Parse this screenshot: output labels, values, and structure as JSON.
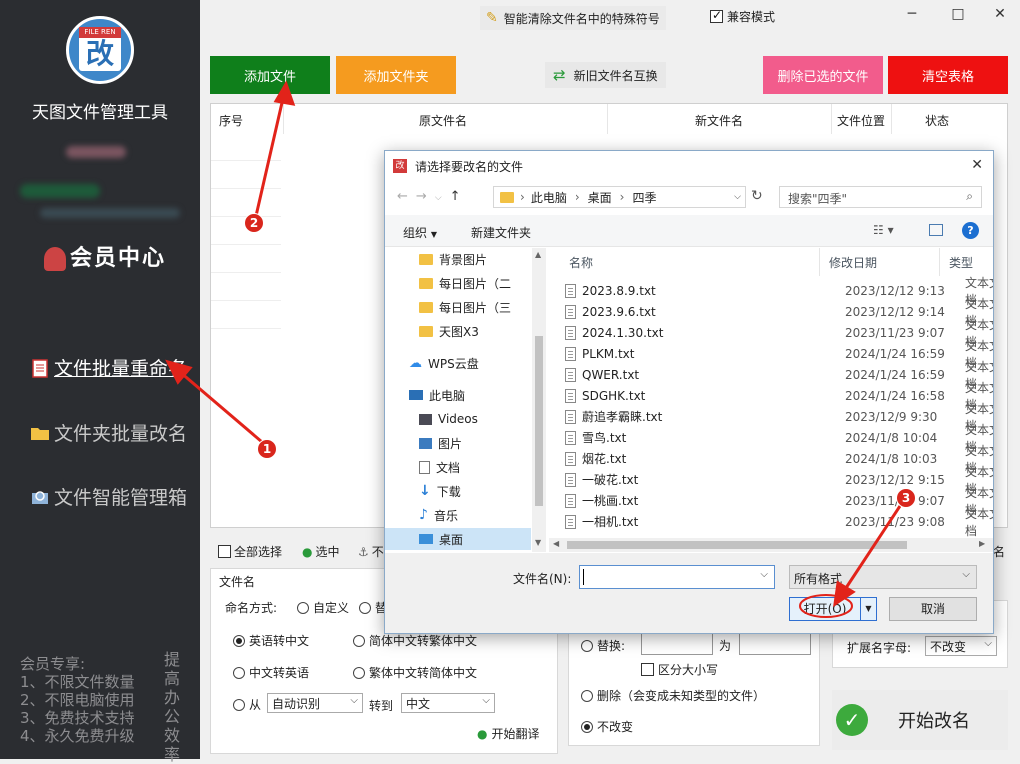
{
  "sidebar": {
    "logo_tag": "FILE REN",
    "logo_char": "改",
    "app_title": "天图文件管理工具",
    "vip_center": "会员中心",
    "nav": [
      {
        "label": "文件批量重命名"
      },
      {
        "label": "文件夹批量改名"
      },
      {
        "label": "文件智能管理箱"
      }
    ],
    "promo_lines": [
      "会员专享:",
      "1、不限文件数量",
      "2、不限电脑使用",
      "3、免费技术支持",
      "4、永久免费升级"
    ],
    "promo_vertical": "提高办公效率"
  },
  "topbar": {
    "special_chars_label": "智能清除文件名中的特殊符号",
    "compat_label": "兼容模式",
    "compat_checked": true,
    "minimize": "─",
    "maximize": "□",
    "close": "✕"
  },
  "toolbar": {
    "add_file": "添加文件",
    "add_folder": "添加文件夹",
    "swap_names": "新旧文件名互换",
    "delete_selected": "删除已选的文件",
    "clear_table": "清空表格",
    "colors": {
      "add_file": "#0f7f1b",
      "add_folder": "#f59b1f",
      "delete_selected": "#f25c8c",
      "clear_table": "#ee1111"
    }
  },
  "table": {
    "headers": [
      "序号",
      "原文件名",
      "新文件名",
      "文件位置",
      "状态"
    ]
  },
  "selection_bar": {
    "select_all": "全部选择",
    "selected": "选中",
    "partial": "不",
    "right_tail": "名"
  },
  "bottom_left": {
    "section_title": "文件名",
    "mode_label": "命名方式:",
    "mode_custom": "自定义",
    "mode_other": "替",
    "options": [
      {
        "label": "英语转中文",
        "checked": true
      },
      {
        "label": "简体中文转繁体中文",
        "checked": false
      },
      {
        "label": "中文转英语",
        "checked": false
      },
      {
        "label": "繁体中文转简体中文",
        "checked": false
      }
    ],
    "from_label": "从",
    "from_value": "自动识别",
    "to_label": "转到",
    "to_value": "中文",
    "translate_btn": "开始翻译"
  },
  "bottom_mid": {
    "replace_label": "替换:",
    "replace_with": "为",
    "case_sensitive": "区分大小写",
    "delete_opt": "删除（会变成未知类型的文件）",
    "no_change": "不改变"
  },
  "bottom_right": {
    "ext_case_label": "扩展名字母:",
    "ext_case_value": "不改变",
    "start_btn": "开始改名"
  },
  "dialog": {
    "title": "请选择要改名的文件",
    "breadcrumb": [
      "此电脑",
      "桌面",
      "四季"
    ],
    "search_placeholder": "搜索\"四季\"",
    "organize": "组织",
    "new_folder": "新建文件夹",
    "nav_items": [
      {
        "label": "背景图片",
        "icon": "folder-icon"
      },
      {
        "label": "每日图片（二",
        "icon": "folder-icon"
      },
      {
        "label": "每日图片（三",
        "icon": "folder-icon"
      },
      {
        "label": "天图X3",
        "icon": "folder-icon"
      },
      {
        "label": "WPS云盘",
        "icon": "cloud-icon"
      },
      {
        "label": "此电脑",
        "icon": "pc-icon"
      },
      {
        "label": "Videos",
        "icon": "videos-icon"
      },
      {
        "label": "图片",
        "icon": "pictures-icon"
      },
      {
        "label": "文档",
        "icon": "documents-icon"
      },
      {
        "label": "下载",
        "icon": "download-icon"
      },
      {
        "label": "音乐",
        "icon": "music-icon"
      },
      {
        "label": "桌面",
        "icon": "desktop-icon",
        "selected": true
      }
    ],
    "columns": [
      "名称",
      "修改日期",
      "类型"
    ],
    "files": [
      {
        "name": "2023.8.9.txt",
        "date": "2023/12/12 9:13",
        "type": "文本文档"
      },
      {
        "name": "2023.9.6.txt",
        "date": "2023/12/12 9:14",
        "type": "文本文档"
      },
      {
        "name": "2024.1.30.txt",
        "date": "2023/11/23 9:07",
        "type": "文本文档"
      },
      {
        "name": "PLKM.txt",
        "date": "2024/1/24 16:59",
        "type": "文本文档"
      },
      {
        "name": "QWER.txt",
        "date": "2024/1/24 16:59",
        "type": "文本文档"
      },
      {
        "name": "SDGHK.txt",
        "date": "2024/1/24 16:58",
        "type": "文本文档"
      },
      {
        "name": "蔚追孝霸睐.txt",
        "date": "2023/12/9 9:30",
        "type": "文本文档"
      },
      {
        "name": "雪鸟.txt",
        "date": "2024/1/8 10:04",
        "type": "文本文档"
      },
      {
        "name": "烟花.txt",
        "date": "2024/1/8 10:03",
        "type": "文本文档"
      },
      {
        "name": "一破花.txt",
        "date": "2023/12/12 9:15",
        "type": "文本文档"
      },
      {
        "name": "一桃画.txt",
        "date": "2023/11/23 9:07",
        "type": "文本文档"
      },
      {
        "name": "一相机.txt",
        "date": "2023/11/23 9:08",
        "type": "文本文档"
      }
    ],
    "filename_label": "文件名(N):",
    "filename_value": "",
    "filetype_value": "所有格式",
    "open_btn": "打开(O)",
    "cancel_btn": "取消"
  },
  "annotations": [
    "1",
    "2",
    "3"
  ]
}
